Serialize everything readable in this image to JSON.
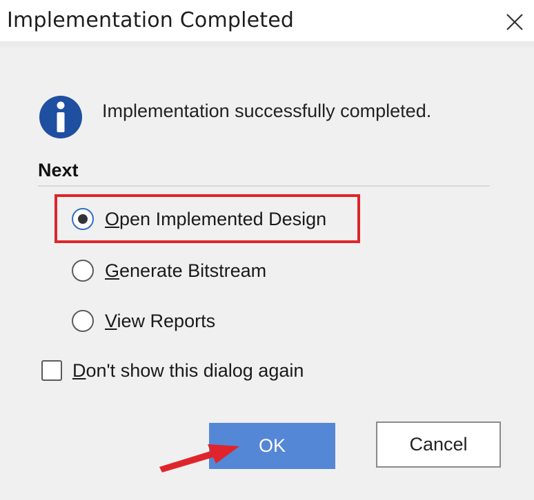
{
  "window": {
    "title": "Implementation Completed",
    "close_icon": "close-icon"
  },
  "message": {
    "icon": "info-icon",
    "text": "Implementation successfully completed."
  },
  "next": {
    "label": "Next",
    "options": [
      {
        "mnemonic": "O",
        "rest": "pen Implemented Design",
        "selected": true
      },
      {
        "mnemonic": "G",
        "rest": "enerate Bitstream",
        "selected": false
      },
      {
        "mnemonic": "V",
        "rest": "iew Reports",
        "selected": false
      }
    ]
  },
  "dont_show": {
    "mnemonic": "D",
    "rest": "on't show this dialog again",
    "checked": false
  },
  "buttons": {
    "ok_label": "OK",
    "cancel_label": "Cancel"
  },
  "annotations": {
    "highlight_color": "#e0242b",
    "arrow_color": "#e0242b"
  },
  "colors": {
    "ok_button": "#5487d6",
    "info_icon": "#1f4fa0",
    "dialog_bg": "#f0f0f0"
  }
}
